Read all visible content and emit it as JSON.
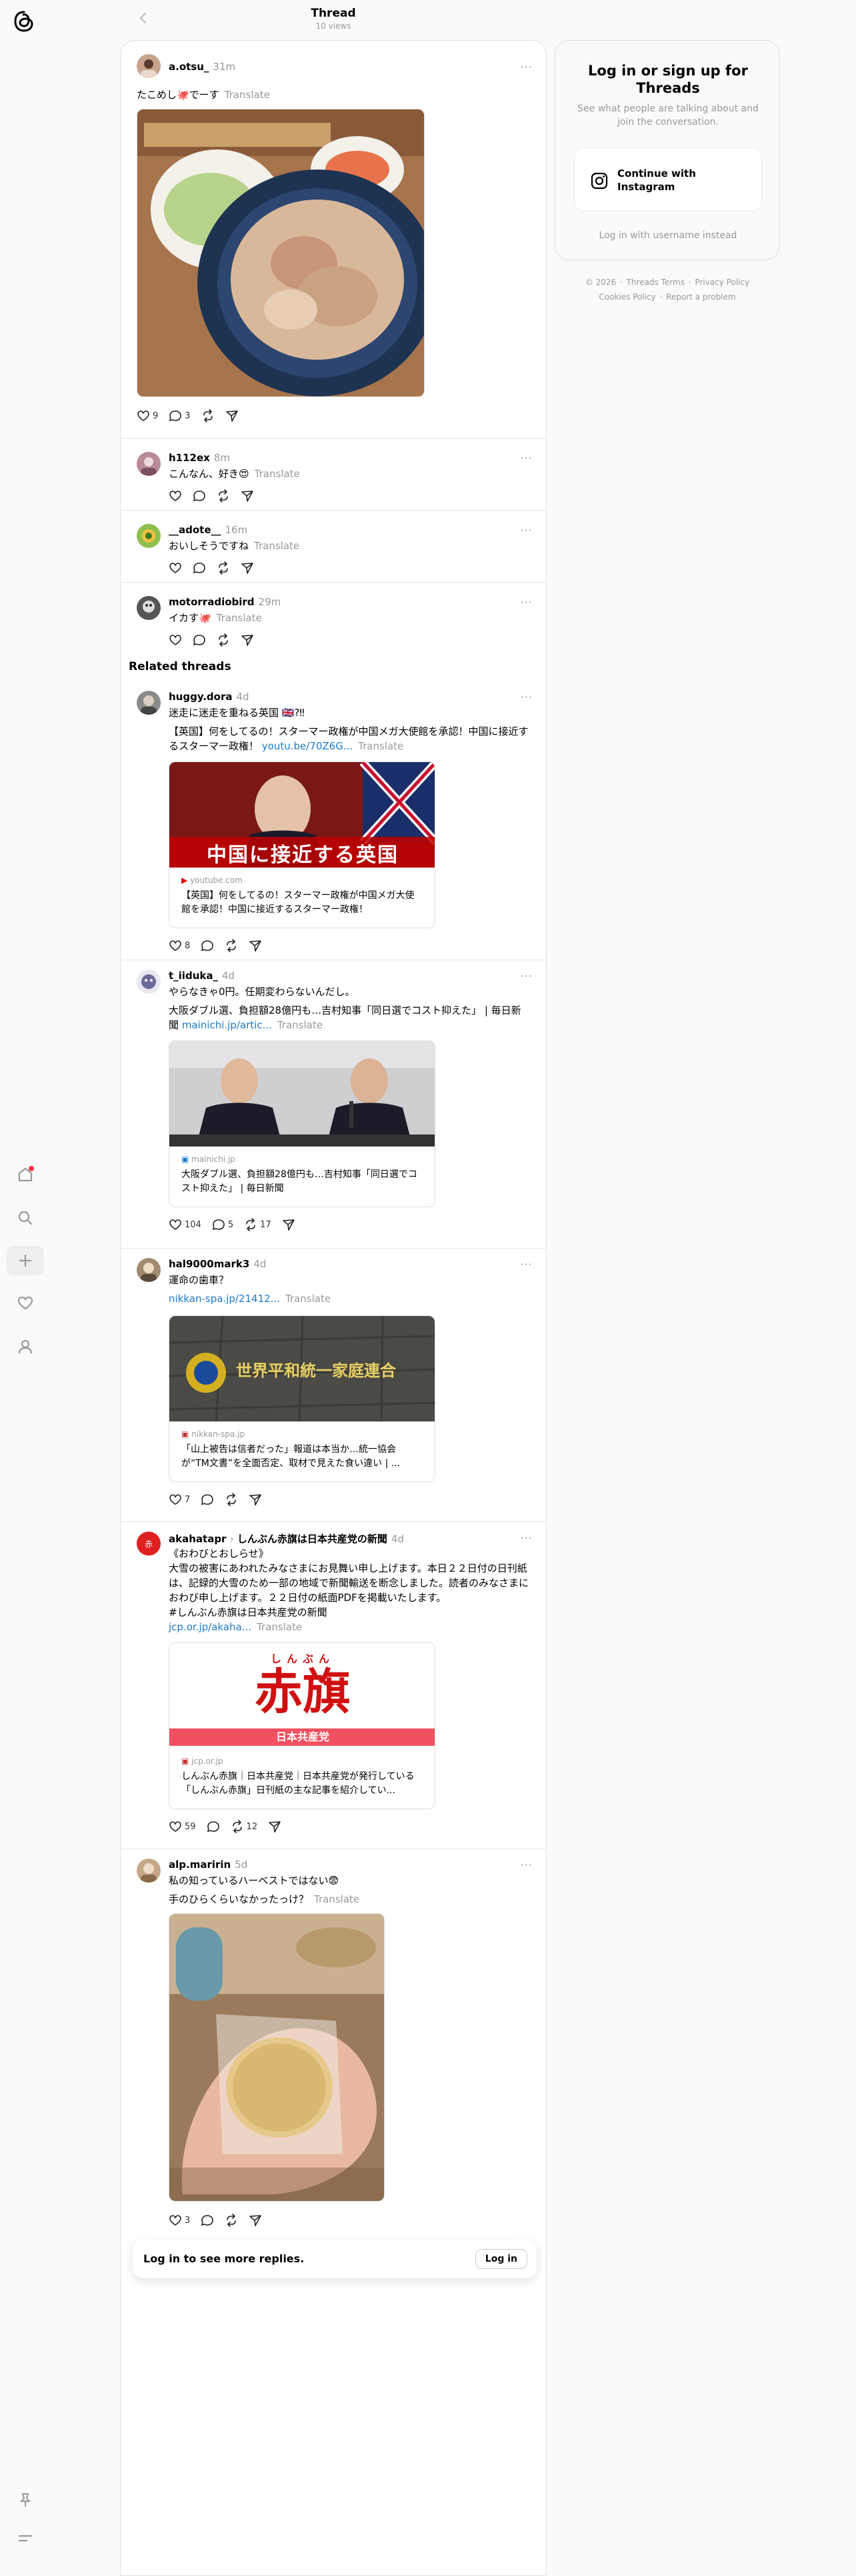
{
  "header": {
    "title": "Thread",
    "views": "10 views"
  },
  "posts": [
    {
      "user": "a.otsu_",
      "time": "31m",
      "text": "たこめし🐙でーす",
      "translate": "Translate",
      "likes": "9",
      "replies": "3"
    },
    {
      "user": "h112ex",
      "time": "8m",
      "text": "こんなん、好き😍",
      "translate": "Translate"
    },
    {
      "user": "__adote__",
      "time": "16m",
      "text": "おいしそうですね",
      "translate": "Translate"
    },
    {
      "user": "motorradiobird",
      "time": "29m",
      "text": "イカす🐙",
      "translate": "Translate"
    }
  ],
  "related_title": "Related threads",
  "related": [
    {
      "user": "huggy.dora",
      "time": "4d",
      "line1": "迷走に迷走を重ねる英国 🇬🇧?‼",
      "line2": "【英国】何をしてるの！スターマー政権が中国メガ大使館を承認！中国に接近するスターマー政権！",
      "link": "youtu.be/70Z6G...",
      "translate": "Translate",
      "card_domain": "youtube.com",
      "card_title": "【英国】何をしてるの！スターマー政権が中国メガ大使館を承認！中国に接近するスターマー政権！",
      "thumb_text": "中国に接近する英国",
      "likes": "8"
    },
    {
      "user": "t_iiduka_",
      "time": "4d",
      "line1": "やらなきゃ0円。任期変わらないんだし。",
      "line2": "大阪ダブル選、負担額28億円も…吉村知事「同日選でコスト抑えた」 | 毎日新聞",
      "link": "mainichi.jp/artic...",
      "translate": "Translate",
      "card_domain": "mainichi.jp",
      "card_title": "大阪ダブル選、負担額28億円も…吉村知事「同日選でコスト抑えた」 | 毎日新聞",
      "likes": "104",
      "replies": "5",
      "reposts": "17"
    },
    {
      "user": "hal9000mark3",
      "time": "4d",
      "line1": "運命の歯車？",
      "link": "nikkan-spa.jp/21412...",
      "translate": "Translate",
      "card_domain": "nikkan-spa.jp",
      "card_title": "「山上被告は信者だった」報道は本当か…統一協会が“TM文書”を全面否定、取材で見えた食い違い | ...",
      "thumb_text": "世界平和統一家庭連合",
      "likes": "7"
    },
    {
      "user": "akahatapr",
      "community": "しんぶん赤旗は日本共産党の新聞",
      "time": "4d",
      "line1": "《おわびとおしらせ》",
      "line2": "大雪の被害にあわれたみなさまにお見舞い申し上げます。本日２２日付の日刊紙は、記録的大雪のため一部の地域で新聞輸送を断念しました。読者のみなさまにおわび申し上げます。２２日付の紙面PDFを掲載いたします。",
      "line3": "#しんぶん赤旗は日本共産党の新聞",
      "link": "jcp.or.jp/akaha...",
      "translate": "Translate",
      "card_domain": "jcp.or.jp",
      "card_title": "しんぶん赤旗｜日本共産党｜日本共産党が発行している「しんぶん赤旗」日刊紙の主な記事を紹介してい...",
      "logo_ruby": "しんぶん",
      "logo_main": "赤旗",
      "logo_sub": "日本共産党",
      "likes": "59",
      "reposts": "12"
    },
    {
      "user": "alp.maririn",
      "time": "5d",
      "line1": "私の知っているハーベストではない😨",
      "line2": "手のひらくらいなかったっけ？",
      "translate": "Translate",
      "likes": "3"
    }
  ],
  "loginbar": {
    "text": "Log in to see more replies.",
    "button": "Log in"
  },
  "right": {
    "title": "Log in or sign up for Threads",
    "subtitle": "See what people are talking about and join the conversation.",
    "ig_button": "Continue with Instagram",
    "username_login": "Log in with username instead"
  },
  "footer": {
    "copyright": "© 2026",
    "terms": "Threads Terms",
    "privacy": "Privacy Policy",
    "cookies": "Cookies Policy",
    "report": "Report a problem"
  }
}
